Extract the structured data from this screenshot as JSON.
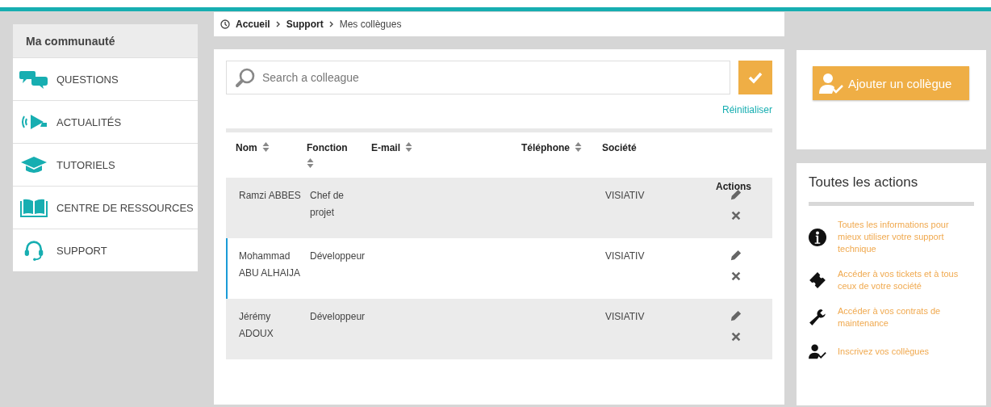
{
  "sidebar": {
    "title": "Ma communauté",
    "items": [
      {
        "label": "QUESTIONS",
        "kind": "chat"
      },
      {
        "label": "ACTUALITÉS",
        "kind": "megaphone"
      },
      {
        "label": "TUTORIELS",
        "kind": "cap"
      },
      {
        "label": "CENTRE DE RESSOURCES",
        "kind": "book"
      },
      {
        "label": "SUPPORT",
        "kind": "headset"
      }
    ]
  },
  "breadcrumb": [
    {
      "label": "Accueil",
      "current": false
    },
    {
      "label": "Support",
      "current": false
    },
    {
      "label": "Mes collègues",
      "current": true
    }
  ],
  "search": {
    "placeholder": "Search a colleague",
    "reset": "Réinitialiser"
  },
  "table": {
    "columns": [
      {
        "label": "Nom",
        "sortable": true
      },
      {
        "label": "Fonction",
        "sortable": true
      },
      {
        "label": "E-mail",
        "sortable": true
      },
      {
        "label": "Téléphone",
        "sortable": true
      },
      {
        "label": "Société",
        "sortable": false
      },
      {
        "label": "Actions",
        "sortable": false
      }
    ],
    "rows": [
      {
        "name": "Ramzi ABBES",
        "function": "Chef de projet",
        "company": "VISIATIV",
        "selected": false
      },
      {
        "name": "Mohammad ABU ALHAIJA",
        "function": "Développeur",
        "company": "VISIATIV",
        "selected": true
      },
      {
        "name": "Jérémy ADOUX",
        "function": "Développeur",
        "company": "VISIATIV",
        "selected": false
      }
    ]
  },
  "add_button": "Ajouter un collègue",
  "actions_panel": {
    "title": "Toutes les actions",
    "items": [
      {
        "label": "Toutes les informations pour mieux utiliser votre support technique",
        "kind": "info"
      },
      {
        "label": "Accéder à vos tickets et à tous ceux de votre société",
        "kind": "ticket"
      },
      {
        "label": "Accéder à vos contrats de maintenance",
        "kind": "wrench"
      },
      {
        "label": "Inscrivez vos collègues",
        "kind": "user"
      }
    ]
  }
}
